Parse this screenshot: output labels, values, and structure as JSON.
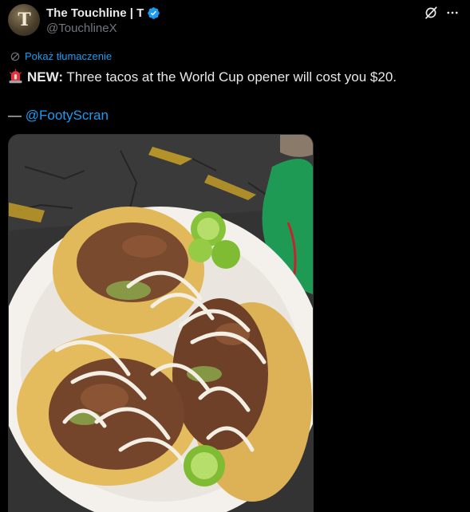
{
  "author": {
    "display_name": "The Touchline | T",
    "handle": "@TouchlineX",
    "avatar_letter": "T",
    "verified": true
  },
  "icons": {
    "verified": "verified-badge-icon",
    "grok": "grok-icon",
    "more": "more-options-icon",
    "translate": "translate-icon",
    "siren": "siren-emoji-icon"
  },
  "translate": {
    "label": "Pokaż tłumaczenie"
  },
  "tweet": {
    "prefix": "NEW:",
    "body": " Three tacos at the World Cup opener will cost you $20.",
    "credit_dash": "— ",
    "mention": "@FootyScran"
  },
  "media": {
    "kind": "photo",
    "subject": "three tacos on a paper plate"
  },
  "colors": {
    "background": "#000000",
    "text": "#e7e9ea",
    "secondary": "#71767b",
    "link": "#1d9bf0",
    "verified": "#1d9bf0"
  }
}
